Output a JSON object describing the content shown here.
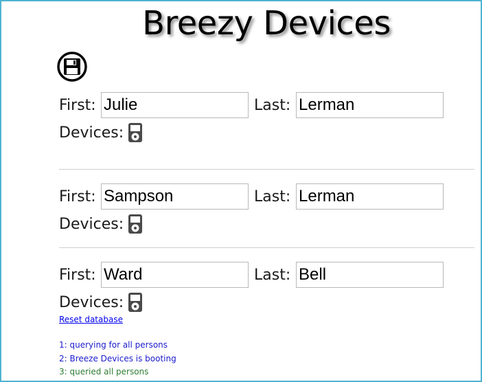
{
  "app": {
    "title": "Breezy Devices"
  },
  "labels": {
    "first": "First:",
    "last": "Last:",
    "devices": "Devices:"
  },
  "persons": [
    {
      "first": "Julie",
      "last": "Lerman"
    },
    {
      "first": "Sampson",
      "last": "Lerman"
    },
    {
      "first": "Ward",
      "last": "Bell"
    }
  ],
  "icons": {
    "save": "save-icon",
    "device": "ipod-icon"
  },
  "reset_link": "Reset database",
  "log": [
    {
      "text": "1: querying for all persons",
      "color": "#1a1acc"
    },
    {
      "text": "2: Breeze Devices is booting",
      "color": "#1a1acc"
    },
    {
      "text": "3: queried all persons",
      "color": "#2e7d32"
    }
  ],
  "colors": {
    "frame_border": "#4fb3cf",
    "link": "#0000ee"
  }
}
